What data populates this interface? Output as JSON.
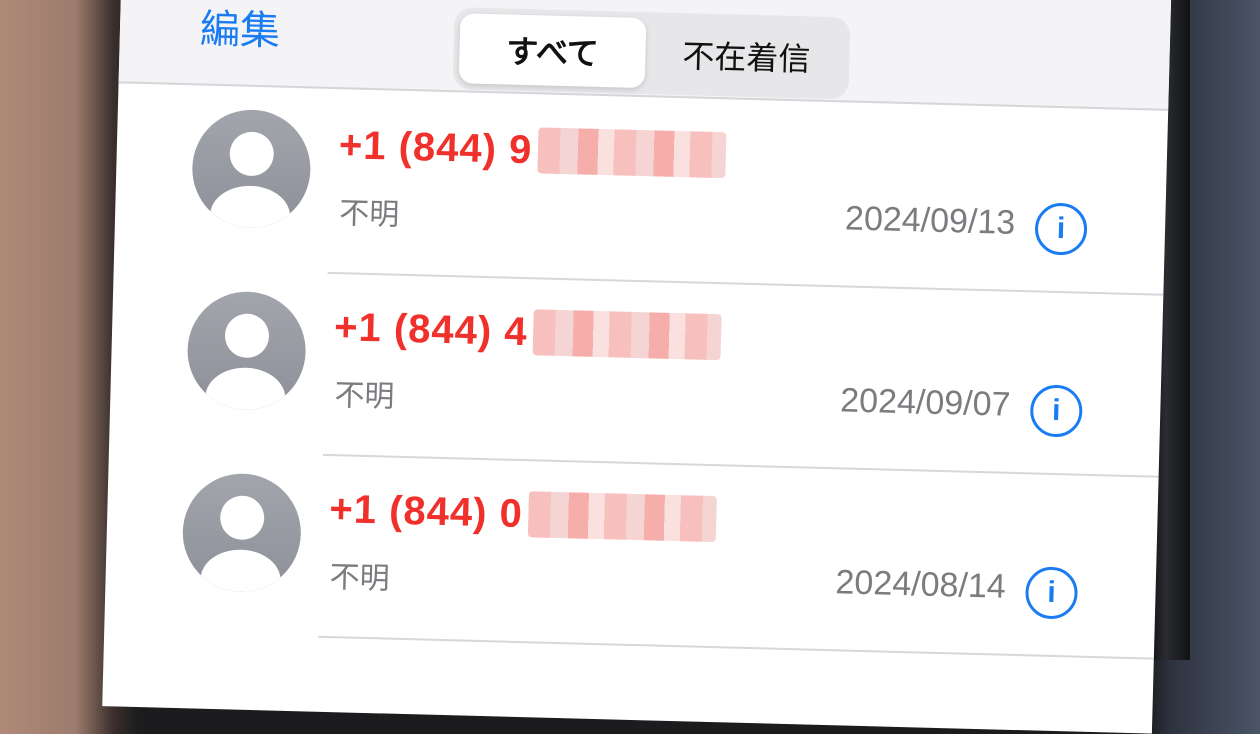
{
  "navbar": {
    "edit_label": "編集",
    "segments": [
      {
        "label": "すべて",
        "selected": true
      },
      {
        "label": "不在着信",
        "selected": false
      }
    ]
  },
  "calls": [
    {
      "number": "+1 (844) 9",
      "label": "不明",
      "date": "2024/09/13",
      "info": "i"
    },
    {
      "number": "+1 (844) 4",
      "label": "不明",
      "date": "2024/09/07",
      "info": "i"
    },
    {
      "number": "+1 (844) 0",
      "label": "不明",
      "date": "2024/08/14",
      "info": "i"
    }
  ],
  "colors": {
    "accent": "#1a7cf2",
    "missed": "#f0302b",
    "secondary_text": "#7b7b80"
  }
}
